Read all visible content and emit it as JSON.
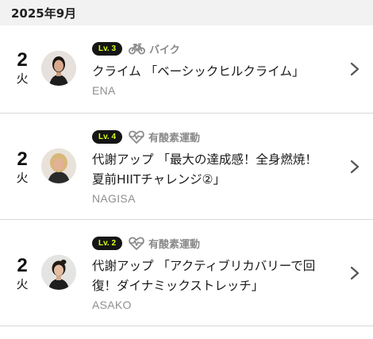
{
  "month_header": "2025年9月",
  "lessons": [
    {
      "day": "2",
      "weekday": "火",
      "level": "Lv. 3",
      "category_icon": "bike-icon",
      "category": "バイク",
      "title_lines": [
        "クライム 「ベーシックヒルクライム」"
      ],
      "instructor": "ENA"
    },
    {
      "day": "2",
      "weekday": "火",
      "level": "Lv. 4",
      "category_icon": "heart-pulse-icon",
      "category": "有酸素運動",
      "title_lines": [
        "代謝アップ 「最大の達成感！全身燃焼！",
        "夏前HIITチャレンジ②」"
      ],
      "instructor": "NAGISA"
    },
    {
      "day": "2",
      "weekday": "火",
      "level": "Lv. 2",
      "category_icon": "heart-pulse-icon",
      "category": "有酸素運動",
      "title_lines": [
        "代謝アップ 「アクティブリカバリーで回",
        "復！ダイナミックストレッチ」"
      ],
      "instructor": "ASAKO"
    }
  ],
  "colors": {
    "badge_bg": "#151515",
    "badge_text": "#d9ff1a",
    "muted": "#8a8a8a",
    "header_bg": "#f2f2f2"
  }
}
